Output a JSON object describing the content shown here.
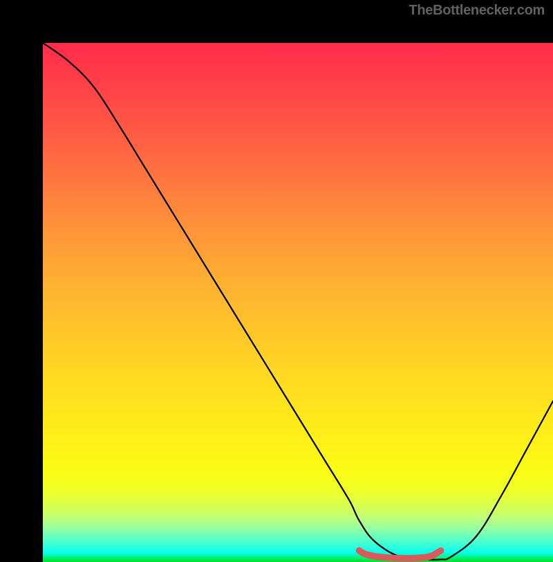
{
  "attribution": "TheBottlenecker.com",
  "chart_data": {
    "type": "line",
    "title": "",
    "xlabel": "",
    "ylabel": "",
    "xlim": [
      0,
      100
    ],
    "ylim": [
      0,
      100
    ],
    "series": [
      {
        "name": "bottleneck-curve",
        "x": [
          0,
          5,
          10,
          15,
          20,
          25,
          30,
          35,
          40,
          45,
          50,
          55,
          60,
          62,
          65,
          70,
          75,
          78,
          80,
          85,
          90,
          95,
          100
        ],
        "values": [
          100,
          96.5,
          91.5,
          84,
          76,
          68,
          60,
          52,
          44,
          36,
          28,
          20,
          12,
          8,
          4,
          1,
          0.5,
          0.5,
          1,
          5,
          13,
          22,
          31
        ],
        "color": "#000000"
      },
      {
        "name": "optimal-range",
        "x": [
          62,
          63,
          65,
          68,
          71,
          74,
          76,
          77,
          78
        ],
        "values": [
          2.2,
          1.6,
          1.1,
          0.8,
          0.7,
          0.8,
          1.1,
          1.6,
          2.2
        ],
        "color": "#d95a5a"
      }
    ],
    "gradient_stops": [
      {
        "pos": 0.0,
        "color": "#ff2b4a"
      },
      {
        "pos": 0.5,
        "color": "#ffc52a"
      },
      {
        "pos": 0.82,
        "color": "#fbfb14"
      },
      {
        "pos": 0.93,
        "color": "#9cff9b"
      },
      {
        "pos": 1.0,
        "color": "#00e12a"
      }
    ]
  }
}
